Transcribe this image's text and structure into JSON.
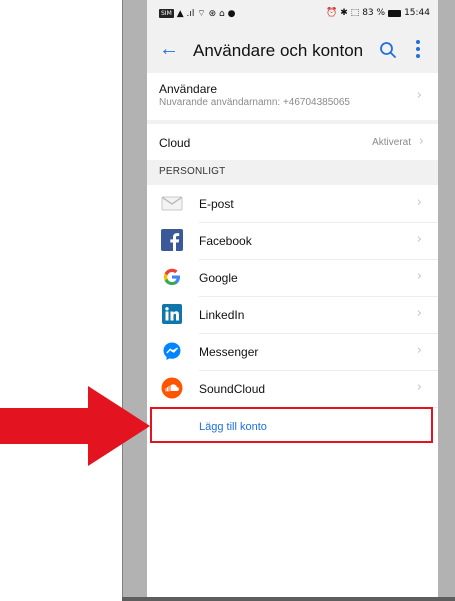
{
  "statusbar": {
    "left_icons": "▲ .ıl ⌔ ⊛ ⌂ ●",
    "sim_label": "SIM",
    "right_icons": "⏰ ✱ ⬚",
    "battery_text": "83 %",
    "time": "15:44"
  },
  "appbar": {
    "back_icon": "arrow-left",
    "title": "Användare och konton",
    "search_icon": "search",
    "more_icon": "more-vertical"
  },
  "user": {
    "label": "Användare",
    "sub": "Nuvarande användarnamn: +46704385065"
  },
  "cloud": {
    "label": "Cloud",
    "status": "Aktiverat"
  },
  "section": {
    "title": "PERSONLIGT"
  },
  "accounts": [
    {
      "label": "E-post",
      "icon": "envelope"
    },
    {
      "label": "Facebook",
      "icon": "facebook"
    },
    {
      "label": "Google",
      "icon": "google"
    },
    {
      "label": "LinkedIn",
      "icon": "linkedin"
    },
    {
      "label": "Messenger",
      "icon": "messenger"
    },
    {
      "label": "SoundCloud",
      "icon": "soundcloud"
    }
  ],
  "add_account": {
    "label": "Lägg till konto"
  },
  "annotation": {
    "highlight_color": "#e3141f",
    "arrow_color": "#e3141f"
  },
  "colors": {
    "accent": "#1f6fdc"
  },
  "chevron": "›"
}
